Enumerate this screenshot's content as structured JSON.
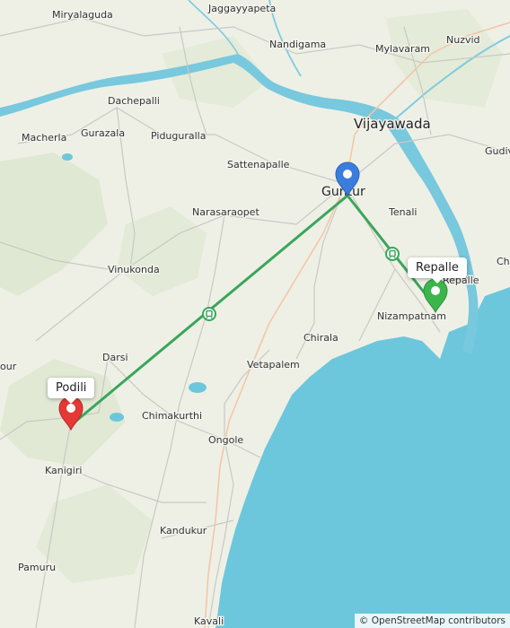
{
  "map": {
    "places": [
      {
        "id": "miryalaguda",
        "name": "Miryalaguda"
      },
      {
        "id": "jaggayyapeta",
        "name": "Jaggayyapeta"
      },
      {
        "id": "nandigama",
        "name": "Nandigama"
      },
      {
        "id": "nuzvid",
        "name": "Nuzvid"
      },
      {
        "id": "mylavaram",
        "name": "Mylavaram"
      },
      {
        "id": "dachepalli",
        "name": "Dachepalli"
      },
      {
        "id": "vijayawada",
        "name": "Vijayawada"
      },
      {
        "id": "macherla",
        "name": "Macherla"
      },
      {
        "id": "gurazala",
        "name": "Gurazala"
      },
      {
        "id": "piduguralla",
        "name": "Piduguralla"
      },
      {
        "id": "gudiv",
        "name": "Gudiv"
      },
      {
        "id": "sattenapalle",
        "name": "Sattenapalle"
      },
      {
        "id": "guntur",
        "name": "Guntur"
      },
      {
        "id": "narasaraopet",
        "name": "Narasaraopet"
      },
      {
        "id": "tenali",
        "name": "Tenali"
      },
      {
        "id": "cha",
        "name": "Cha"
      },
      {
        "id": "vinukonda",
        "name": "Vinukonda"
      },
      {
        "id": "repalle_town",
        "name": "Repalle"
      },
      {
        "id": "nizampatnam",
        "name": "Nizampatnam"
      },
      {
        "id": "chirala",
        "name": "Chirala"
      },
      {
        "id": "darsi",
        "name": "Darsi"
      },
      {
        "id": "vetapalem",
        "name": "Vetapalem"
      },
      {
        "id": "our",
        "name": "our"
      },
      {
        "id": "chimakurthi",
        "name": "Chimakurthi"
      },
      {
        "id": "ongole",
        "name": "Ongole"
      },
      {
        "id": "kanigiri",
        "name": "Kanigiri"
      },
      {
        "id": "kandukur",
        "name": "Kandukur"
      },
      {
        "id": "pamuru",
        "name": "Pamuru"
      },
      {
        "id": "kavali",
        "name": "Kavali"
      }
    ],
    "markers": [
      {
        "id": "guntur",
        "color": "#3b7ddd"
      },
      {
        "id": "repalle",
        "color": "#3cb54a",
        "label": "Repalle"
      },
      {
        "id": "podili",
        "color": "#e53935",
        "label": "Podili"
      }
    ],
    "route_color": "#3aa65a",
    "water_color": "#6cc7dc",
    "land_color": "#eef0e6",
    "attribution": "© OpenStreetMap contributors"
  }
}
